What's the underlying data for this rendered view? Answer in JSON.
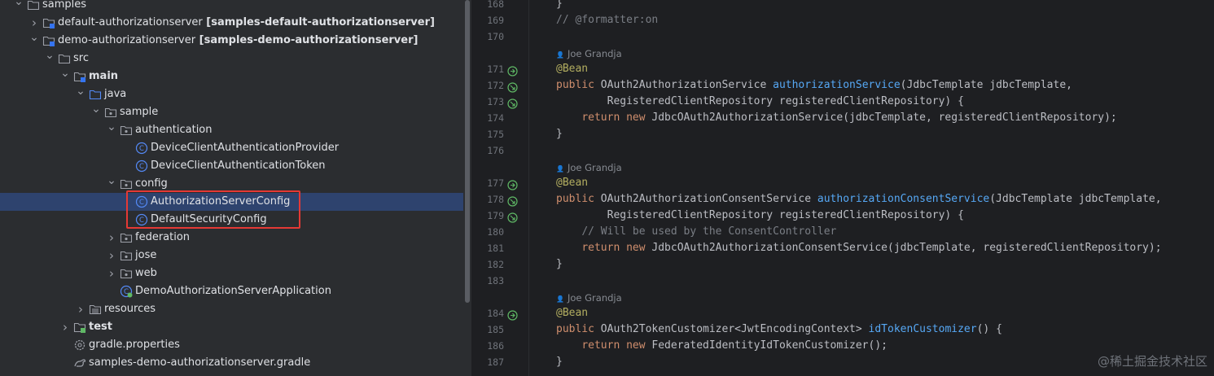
{
  "tree": [
    {
      "label": "samples",
      "bold_suffix": "",
      "chevron": "down",
      "icon": "folder",
      "indent": 0,
      "selected": false
    },
    {
      "label": "default-authorizationserver",
      "bold_suffix": " [samples-default-authorizationserver]",
      "chevron": "right",
      "icon": "module-folder",
      "indent": 1,
      "selected": false
    },
    {
      "label": "demo-authorizationserver",
      "bold_suffix": " [samples-demo-authorizationserver]",
      "chevron": "down",
      "icon": "module-folder",
      "indent": 1,
      "selected": false
    },
    {
      "label": "src",
      "bold_suffix": "",
      "chevron": "down",
      "icon": "folder",
      "indent": 2,
      "selected": false
    },
    {
      "label": "main",
      "bold_suffix": "",
      "bold_label": true,
      "chevron": "down",
      "icon": "source-folder",
      "indent": 3,
      "selected": false
    },
    {
      "label": "java",
      "bold_suffix": "",
      "chevron": "down",
      "icon": "java-folder",
      "indent": 4,
      "selected": false
    },
    {
      "label": "sample",
      "bold_suffix": "",
      "chevron": "down",
      "icon": "package",
      "indent": 5,
      "selected": false
    },
    {
      "label": "authentication",
      "bold_suffix": "",
      "chevron": "down",
      "icon": "package",
      "indent": 6,
      "selected": false
    },
    {
      "label": "DeviceClientAuthenticationProvider",
      "bold_suffix": "",
      "chevron": "",
      "icon": "class",
      "indent": 7,
      "selected": false
    },
    {
      "label": "DeviceClientAuthenticationToken",
      "bold_suffix": "",
      "chevron": "",
      "icon": "class",
      "indent": 7,
      "selected": false
    },
    {
      "label": "config",
      "bold_suffix": "",
      "chevron": "down",
      "icon": "package",
      "indent": 6,
      "selected": false
    },
    {
      "label": "AuthorizationServerConfig",
      "bold_suffix": "",
      "chevron": "",
      "icon": "class",
      "indent": 7,
      "selected": true
    },
    {
      "label": "DefaultSecurityConfig",
      "bold_suffix": "",
      "chevron": "",
      "icon": "class",
      "indent": 7,
      "selected": false
    },
    {
      "label": "federation",
      "bold_suffix": "",
      "chevron": "right",
      "icon": "package",
      "indent": 6,
      "selected": false
    },
    {
      "label": "jose",
      "bold_suffix": "",
      "chevron": "right",
      "icon": "package",
      "indent": 6,
      "selected": false
    },
    {
      "label": "web",
      "bold_suffix": "",
      "chevron": "right",
      "icon": "package",
      "indent": 6,
      "selected": false
    },
    {
      "label": "DemoAuthorizationServerApplication",
      "bold_suffix": "",
      "chevron": "",
      "icon": "spring-class",
      "indent": 6,
      "selected": false
    },
    {
      "label": "resources",
      "bold_suffix": "",
      "chevron": "right",
      "icon": "resources-folder",
      "indent": 4,
      "selected": false
    },
    {
      "label": "test",
      "bold_suffix": "",
      "bold_label": true,
      "chevron": "right",
      "icon": "test-folder",
      "indent": 3,
      "selected": false
    },
    {
      "label": "gradle.properties",
      "bold_suffix": "",
      "chevron": "",
      "icon": "settings",
      "indent": 3,
      "selected": false
    },
    {
      "label": "samples-demo-authorizationserver.gradle",
      "bold_suffix": "",
      "chevron": "",
      "icon": "gradle",
      "indent": 3,
      "selected": false
    }
  ],
  "editor": {
    "lines": [
      {
        "n": "168",
        "kind": "code",
        "gicon": "",
        "tokens": [
          {
            "t": "}",
            "c": ""
          }
        ]
      },
      {
        "n": "169",
        "kind": "code",
        "gicon": "",
        "tokens": [
          {
            "t": "// @formatter:on",
            "c": "cmt"
          }
        ]
      },
      {
        "n": "170",
        "kind": "code",
        "gicon": "",
        "tokens": []
      },
      {
        "n": "",
        "kind": "author",
        "text": "Joe Grandja"
      },
      {
        "n": "171",
        "kind": "code",
        "gicon": "bean",
        "tokens": [
          {
            "t": "@Bean",
            "c": "ann"
          }
        ]
      },
      {
        "n": "172",
        "kind": "code",
        "gicon": "inject",
        "tokens": [
          {
            "t": "public ",
            "c": "kw"
          },
          {
            "t": "OAuth2AuthorizationService ",
            "c": ""
          },
          {
            "t": "authorizationService",
            "c": "fn"
          },
          {
            "t": "(JdbcTemplate jdbcTemplate,",
            "c": ""
          }
        ]
      },
      {
        "n": "173",
        "kind": "code",
        "gicon": "inject",
        "tokens": [
          {
            "t": "        RegisteredClientRepository registeredClientRepository) {",
            "c": ""
          }
        ]
      },
      {
        "n": "174",
        "kind": "code",
        "gicon": "",
        "tokens": [
          {
            "t": "    ",
            "c": ""
          },
          {
            "t": "return new ",
            "c": "kw"
          },
          {
            "t": "JdbcOAuth2AuthorizationService(jdbcTemplate, registeredClientRepository);",
            "c": ""
          }
        ]
      },
      {
        "n": "175",
        "kind": "code",
        "gicon": "",
        "tokens": [
          {
            "t": "}",
            "c": ""
          }
        ]
      },
      {
        "n": "176",
        "kind": "code",
        "gicon": "",
        "tokens": []
      },
      {
        "n": "",
        "kind": "author",
        "text": "Joe Grandja"
      },
      {
        "n": "177",
        "kind": "code",
        "gicon": "bean",
        "tokens": [
          {
            "t": "@Bean",
            "c": "ann"
          }
        ]
      },
      {
        "n": "178",
        "kind": "code",
        "gicon": "inject",
        "tokens": [
          {
            "t": "public ",
            "c": "kw"
          },
          {
            "t": "OAuth2AuthorizationConsentService ",
            "c": ""
          },
          {
            "t": "authorizationConsentService",
            "c": "fn"
          },
          {
            "t": "(JdbcTemplate jdbcTemplate,",
            "c": ""
          }
        ]
      },
      {
        "n": "179",
        "kind": "code",
        "gicon": "inject",
        "tokens": [
          {
            "t": "        RegisteredClientRepository registeredClientRepository) {",
            "c": ""
          }
        ]
      },
      {
        "n": "180",
        "kind": "code",
        "gicon": "",
        "tokens": [
          {
            "t": "    ",
            "c": ""
          },
          {
            "t": "// Will be used by the ConsentController",
            "c": "cmt"
          }
        ]
      },
      {
        "n": "181",
        "kind": "code",
        "gicon": "",
        "tokens": [
          {
            "t": "    ",
            "c": ""
          },
          {
            "t": "return new ",
            "c": "kw"
          },
          {
            "t": "JdbcOAuth2AuthorizationConsentService(jdbcTemplate, registeredClientRepository);",
            "c": ""
          }
        ]
      },
      {
        "n": "182",
        "kind": "code",
        "gicon": "",
        "tokens": [
          {
            "t": "}",
            "c": ""
          }
        ]
      },
      {
        "n": "183",
        "kind": "code",
        "gicon": "",
        "tokens": []
      },
      {
        "n": "",
        "kind": "author",
        "text": "Joe Grandja"
      },
      {
        "n": "184",
        "kind": "code",
        "gicon": "bean",
        "tokens": [
          {
            "t": "@Bean",
            "c": "ann"
          }
        ]
      },
      {
        "n": "185",
        "kind": "code",
        "gicon": "",
        "tokens": [
          {
            "t": "public ",
            "c": "kw"
          },
          {
            "t": "OAuth2TokenCustomizer<JwtEncodingContext> ",
            "c": ""
          },
          {
            "t": "idTokenCustomizer",
            "c": "fn"
          },
          {
            "t": "() {",
            "c": ""
          }
        ]
      },
      {
        "n": "186",
        "kind": "code",
        "gicon": "",
        "tokens": [
          {
            "t": "    ",
            "c": ""
          },
          {
            "t": "return new ",
            "c": "kw"
          },
          {
            "t": "FederatedIdentityIdTokenCustomizer();",
            "c": ""
          }
        ]
      },
      {
        "n": "187",
        "kind": "code",
        "gicon": "",
        "tokens": [
          {
            "t": "}",
            "c": ""
          }
        ]
      }
    ]
  },
  "watermark": "@稀土掘金技术社区",
  "colors": {
    "selection": "#2e436e",
    "highlight_box": "#e53935",
    "keyword": "#cf8e6d",
    "annotation": "#b3ae60",
    "method": "#56a8f5",
    "comment": "#7a7e85"
  }
}
